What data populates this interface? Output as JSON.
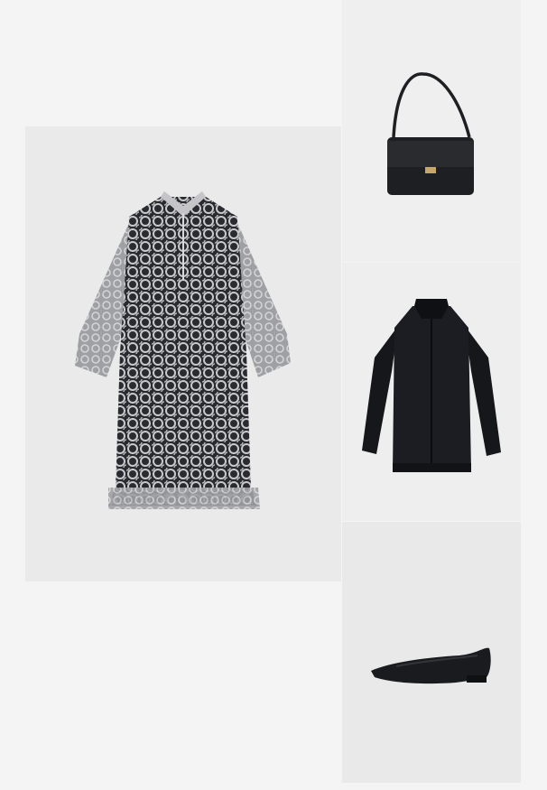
{
  "outfit": {
    "items": [
      {
        "id": "dress",
        "product": "lace-shirt-dress",
        "color": "#b9b9bd"
      },
      {
        "id": "bag",
        "product": "black-shoulder-bag",
        "color": "#1e1f22"
      },
      {
        "id": "jacket",
        "product": "black-bomber-jacket",
        "color": "#15171b"
      },
      {
        "id": "shoes",
        "product": "black-pointed-ballet-flats",
        "color": "#1a1b1e"
      }
    ]
  }
}
